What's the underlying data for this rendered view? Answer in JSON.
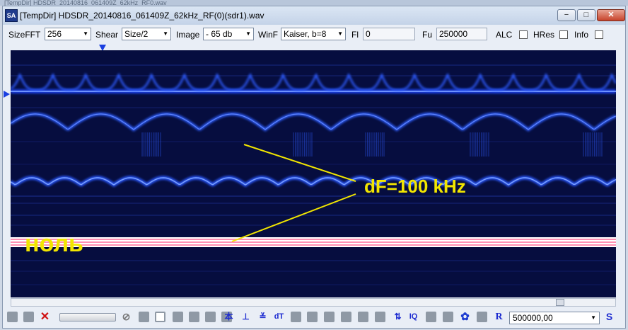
{
  "background_window_title": "[TempDir] HDSDR_20140816_061409Z_62kHz_RF0.wav",
  "window": {
    "app_icon": "SA",
    "title": "[TempDir] HDSDR_20140816_061409Z_62kHz_RF(0)(sdr1).wav",
    "minimize_glyph": "−",
    "maximize_glyph": "□",
    "close_glyph": "✕"
  },
  "toolbar": {
    "sizefft_label": "SizeFFT",
    "sizefft_value": "256",
    "shear_label": "Shear",
    "shear_value": "Size/2",
    "image_label": "Image",
    "image_value": "- 65 db",
    "winf_label": "WinF",
    "winf_value": "Kaiser, b=8",
    "fl_label": "Fl",
    "fl_value": "0",
    "fu_label": "Fu",
    "fu_value": "250000",
    "alc_label": "ALC",
    "alc_checked": false,
    "hres_label": "HRes",
    "hres_checked": false,
    "info_label": "Info",
    "info_checked": false
  },
  "annotations": {
    "df_label": "dF=100 kHz",
    "zero_label": "ноль",
    "label_color": "#f2e600",
    "zero_line_color": "#ff8fb3",
    "signal_color": "#3a6bff"
  },
  "bottombar": {
    "icons": [
      "save-icon",
      "save-all-icon",
      "delete-icon",
      "slider",
      "stop-icon",
      "gray-icon",
      "frame-icon",
      "gray-icon",
      "gray-icon",
      "gray-icon",
      "gray-icon",
      "split-icon",
      "merge-icon",
      "align-icon",
      "dt-icon",
      "gray-icon",
      "gray-icon",
      "gray-icon",
      "gray-icon",
      "gray-icon",
      "gray-icon",
      "gray-icon",
      "swap-icon",
      "iq-icon",
      "gray-icon",
      "gray-icon",
      "settings-icon",
      "copy-icon",
      "r-icon"
    ],
    "split_glyph": "本",
    "merge_glyph": "⊥",
    "align_glyph": "≚",
    "dt_label": "dT",
    "swap_glyph": "⇅",
    "iq_label": "IQ",
    "r_label": "R",
    "frequency_value": "500000,00",
    "s_label": "S"
  }
}
